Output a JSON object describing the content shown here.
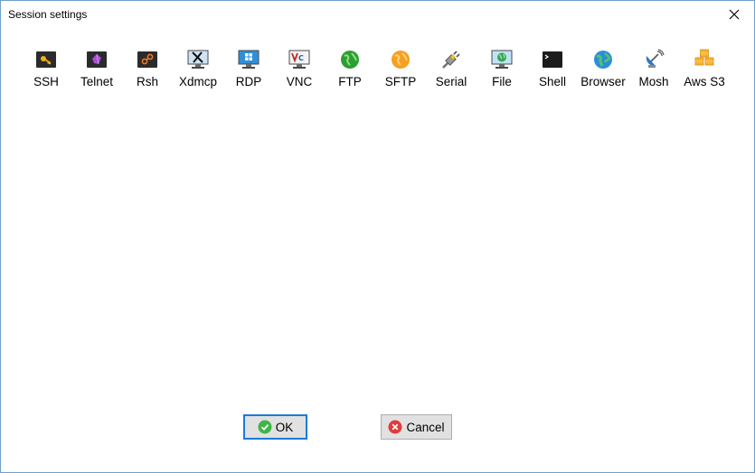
{
  "window": {
    "title": "Session settings",
    "close_glyph": "✕"
  },
  "session_types": [
    {
      "label": "SSH",
      "icon": "ssh-key-icon"
    },
    {
      "label": "Telnet",
      "icon": "telnet-gem-icon"
    },
    {
      "label": "Rsh",
      "icon": "rsh-link-icon"
    },
    {
      "label": "Xdmcp",
      "icon": "xdmcp-monitor-icon"
    },
    {
      "label": "RDP",
      "icon": "rdp-windows-icon"
    },
    {
      "label": "VNC",
      "icon": "vnc-monitor-icon"
    },
    {
      "label": "FTP",
      "icon": "ftp-globe-icon"
    },
    {
      "label": "SFTP",
      "icon": "sftp-globe-icon"
    },
    {
      "label": "Serial",
      "icon": "serial-plug-icon"
    },
    {
      "label": "File",
      "icon": "file-monitor-icon"
    },
    {
      "label": "Shell",
      "icon": "shell-terminal-icon"
    },
    {
      "label": "Browser",
      "icon": "browser-globe-icon"
    },
    {
      "label": "Mosh",
      "icon": "mosh-satellite-icon"
    },
    {
      "label": "Aws S3",
      "icon": "aws-s3-cubes-icon"
    }
  ],
  "buttons": {
    "ok_label": "OK",
    "cancel_label": "Cancel"
  },
  "colors": {
    "window_border": "#6f9fcf",
    "ok_border": "#1e7ad6",
    "button_face": "#e1e1e1",
    "ok_icon": "#3fb548",
    "cancel_icon": "#e23b3b"
  }
}
